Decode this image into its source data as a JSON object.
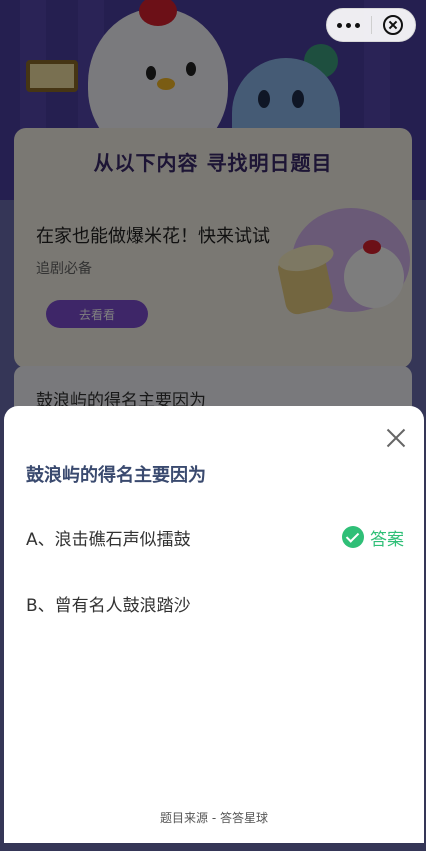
{
  "background": {
    "card_title": "从以下内容 寻找明日题目",
    "promo": {
      "title": "在家也能做爆米花！快来试试",
      "subtitle": "追剧必备",
      "button": "去看看"
    },
    "question_preview": "鼓浪屿的得名主要因为"
  },
  "capsule": {
    "more_icon": "more-dots-icon",
    "close_icon": "close-circle-icon"
  },
  "sheet": {
    "question": "鼓浪屿的得名主要因为",
    "options": [
      {
        "label": "A、浪击礁石声似擂鼓",
        "is_answer": true
      },
      {
        "label": "B、曾有名人鼓浪踏沙",
        "is_answer": false
      }
    ],
    "answer_tag": "答案",
    "answer_color": "#2fbf77",
    "source": "题目来源 - 答答星球"
  }
}
